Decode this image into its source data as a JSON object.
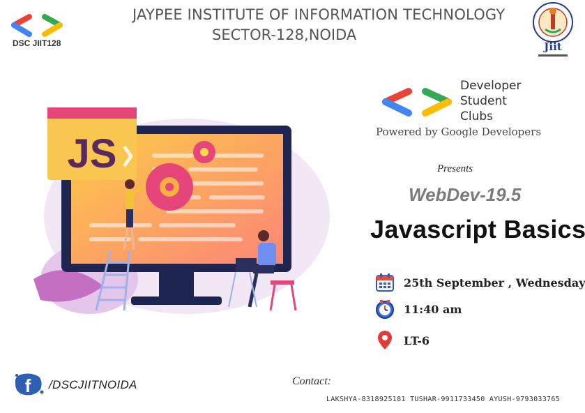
{
  "header": {
    "club_logo_label": "DSC JIIT128",
    "institute_line1": "JAYPEE INSTITUTE OF INFORMATION TECHNOLOGY",
    "institute_line2": "SECTOR-128,NOIDA",
    "seal_text": "JAYPEE INSTITUTE OF INFORMATION TECHNOLOGY",
    "seal_abbrev": "Jiit"
  },
  "illustration": {
    "badge_text": "JS"
  },
  "brand": {
    "name_line1": "Developer",
    "name_line2": "Student",
    "name_line3": "Clubs",
    "powered_by": "Powered by Google Developers"
  },
  "event": {
    "presents": "Presents",
    "series": "WebDev-19.5",
    "title": "Javascript Basics",
    "date": "25th September , Wednesday",
    "time": "11:40 am",
    "venue": "LT-6"
  },
  "footer": {
    "facebook_handle": "/DSCJIITNOIDA",
    "contact_label": "Contact:",
    "contact_numbers": "LAKSHYA-8318925181 TUSHAR-9911733450 AYUSH-9793033765"
  },
  "icons": {
    "logo": "dsc-brackets-icon",
    "seal": "jiit-seal-icon",
    "date": "calendar-icon",
    "time": "clock-icon",
    "venue": "location-pin-icon",
    "social": "facebook-icon"
  },
  "colors": {
    "google_red": "#ea4335",
    "google_blue": "#4285f4",
    "google_green": "#34a853",
    "google_yellow": "#fbbc04",
    "series_gray": "#7b7b7b"
  }
}
